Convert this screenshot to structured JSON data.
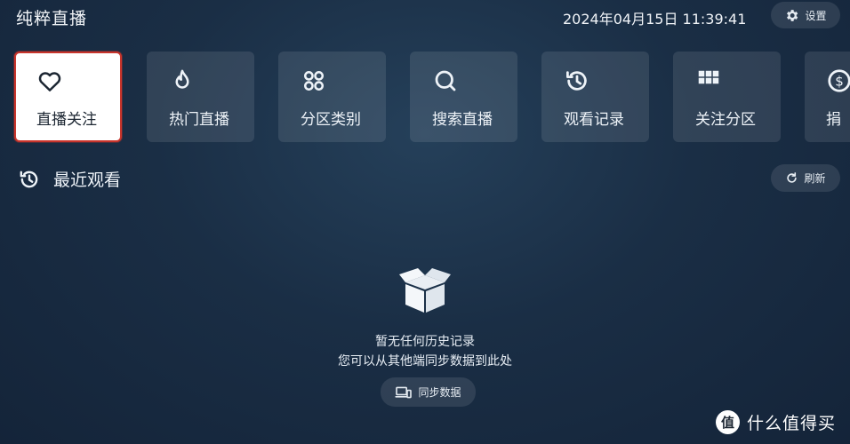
{
  "app": {
    "title": "纯粹直播"
  },
  "header": {
    "datetime": "2024年04月15日 11:39:41",
    "settings_label": "设置"
  },
  "tiles": [
    {
      "label": "直播关注",
      "icon": "heart-icon",
      "active": true
    },
    {
      "label": "热门直播",
      "icon": "flame-icon"
    },
    {
      "label": "分区类别",
      "icon": "category-icon"
    },
    {
      "label": "搜索直播",
      "icon": "search-icon"
    },
    {
      "label": "观看记录",
      "icon": "history-icon"
    },
    {
      "label": "关注分区",
      "icon": "grid-icon"
    },
    {
      "label": "捐",
      "icon": "donate-icon"
    }
  ],
  "recent": {
    "title": "最近观看",
    "refresh_label": "刷新"
  },
  "empty_state": {
    "line1": "暂无任何历史记录",
    "line2": "您可以从其他端同步数据到此处",
    "sync_label": "同步数据"
  },
  "watermark": {
    "logo": "值",
    "text": "什么值得买"
  },
  "colors": {
    "accent_border": "#c9352c",
    "background": "#1a2e45"
  }
}
